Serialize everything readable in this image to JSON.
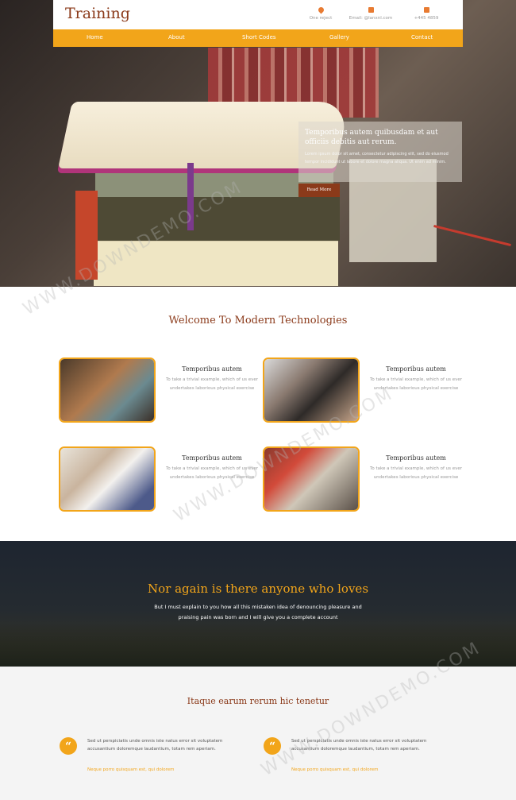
{
  "header": {
    "logo": "Training",
    "contacts": [
      {
        "icon": "map-pin-icon",
        "text": "One reject"
      },
      {
        "icon": "envelope-icon",
        "text": "Email: @lanxnl.com"
      },
      {
        "icon": "phone-icon",
        "text": "+445 4859"
      }
    ]
  },
  "nav": {
    "items": [
      "Home",
      "About",
      "Short Codes",
      "Gallery",
      "Contact"
    ]
  },
  "hero": {
    "caption_title": "Temporibus autem quibusdam et aut officiis debitis aut rerum.",
    "caption_text": "Lorem ipsum dolor sit amet, consectetur adipiscing elit, sed do eiusmod tempor incididunt ut labore et dolore magna aliqua. Ut enim ad minim.",
    "read_more": "Read More"
  },
  "welcome": {
    "title": "Welcome To Modern Technologies",
    "features": [
      {
        "title": "Temporibus autem",
        "desc": "To take a trivial example, which of us ever undertakes laborious physical exercise"
      },
      {
        "title": "Temporibus autem",
        "desc": "To take a trivial example, which of us ever undertakes laborious physical exercise"
      },
      {
        "title": "Temporibus autem",
        "desc": "To take a trivial example, which of us ever undertakes laborious physical exercise"
      },
      {
        "title": "Temporibus autem",
        "desc": "To take a trivial example, which of us ever undertakes laborious physical exercise"
      }
    ]
  },
  "banner": {
    "title": "Nor again is there anyone who loves",
    "text": "But I must explain to you how all this mistaken idea of denouncing pleasure and praising pain was born and I will give you a complete account"
  },
  "testimonials": {
    "title": "Itaque earum rerum hic tenetur",
    "items": [
      {
        "text": "Sed ut perspiciatis unde omnis iste natus error sit voluptatem accusantium doloremque laudantium, totam rem aperiam.",
        "author": "Neque porro quisquam est, qui dolorem"
      },
      {
        "text": "Sed ut perspiciatis unde omnis iste natus error sit voluptatem accusantium doloremque laudantium, totam rem aperiam.",
        "author": "Neque porro quisquam est, qui dolorem"
      }
    ]
  },
  "watermark": "WWW.DOWNDEMO.COM",
  "colors": {
    "accent": "#f2a51a",
    "brand": "#8b3a1a",
    "banner_bg": "#1e2530",
    "testimonial_bg": "#f4f4f4"
  }
}
